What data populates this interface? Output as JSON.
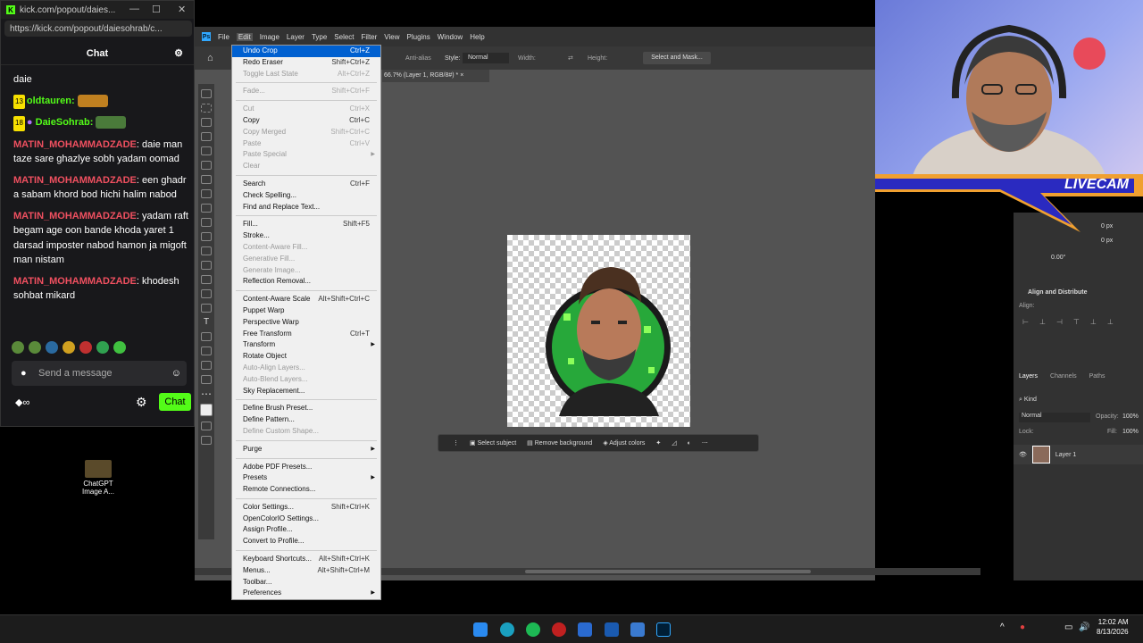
{
  "chat_window": {
    "title": "kick.com/popout/daies...",
    "url": "https://kick.com/popout/daiesohrab/c...",
    "header": "Chat",
    "messages": [
      {
        "user": "",
        "text": "daie"
      },
      {
        "badge": "13",
        "user": "oldtauren:",
        "text": ""
      },
      {
        "badge": "18",
        "user": "DaieSohrab:",
        "text": ""
      },
      {
        "user": "MATIN_MOHAMMADZADE",
        "text": ": daie man taze sare ghazlye sobh yadam oomad"
      },
      {
        "user": "MATIN_MOHAMMADZADE",
        "text": ": een ghadr a sabam khord bod hichi halim nabod"
      },
      {
        "user": "MATIN_MOHAMMADZADE",
        "text": ": yadam raft begam age oon bande khoda yaret 1 darsad imposter nabod hamon ja migoft man nistam"
      },
      {
        "user": "MATIN_MOHAMMADZADE",
        "text": ": khodesh sohbat mikard"
      }
    ],
    "input_placeholder": "Send a message",
    "send_label": "Chat",
    "infinity": "∞"
  },
  "desktop_icon": {
    "label": "ChatGPT Image A..."
  },
  "photoshop": {
    "menus": [
      "File",
      "Edit",
      "Image",
      "Layer",
      "Type",
      "Select",
      "Filter",
      "View",
      "Plugins",
      "Window",
      "Help"
    ],
    "options": {
      "antialias": "Anti-alias",
      "style_label": "Style:",
      "style_value": "Normal",
      "width": "Width:",
      "height": "Height:",
      "select_mask": "Select and Mask..."
    },
    "doc_tab": "66.7% (Layer 1, RGB/8#) *",
    "context_bar": [
      "Select subject",
      "Remove background",
      "Adjust colors"
    ],
    "edit_menu": [
      {
        "label": "Undo Crop",
        "sc": "Ctrl+Z",
        "state": "hl"
      },
      {
        "label": "Redo Eraser",
        "sc": "Shift+Ctrl+Z"
      },
      {
        "label": "Toggle Last State",
        "sc": "Alt+Ctrl+Z",
        "state": "dis"
      },
      {
        "sep": true
      },
      {
        "label": "Fade...",
        "sc": "Shift+Ctrl+F",
        "state": "dis"
      },
      {
        "sep": true
      },
      {
        "label": "Cut",
        "sc": "Ctrl+X",
        "state": "dis"
      },
      {
        "label": "Copy",
        "sc": "Ctrl+C"
      },
      {
        "label": "Copy Merged",
        "sc": "Shift+Ctrl+C",
        "state": "dis"
      },
      {
        "label": "Paste",
        "sc": "Ctrl+V",
        "state": "dis"
      },
      {
        "label": "Paste Special",
        "sc": "",
        "state": "dis",
        "sub": true
      },
      {
        "label": "Clear",
        "sc": "",
        "state": "dis"
      },
      {
        "sep": true
      },
      {
        "label": "Search",
        "sc": "Ctrl+F"
      },
      {
        "label": "Check Spelling...",
        "sc": ""
      },
      {
        "label": "Find and Replace Text...",
        "sc": ""
      },
      {
        "sep": true
      },
      {
        "label": "Fill...",
        "sc": "Shift+F5"
      },
      {
        "label": "Stroke...",
        "sc": ""
      },
      {
        "label": "Content-Aware Fill...",
        "sc": "",
        "state": "dis"
      },
      {
        "label": "Generative Fill...",
        "sc": "",
        "state": "dis"
      },
      {
        "label": "Generate Image...",
        "sc": "",
        "state": "dis"
      },
      {
        "label": "Reflection Removal...",
        "sc": ""
      },
      {
        "sep": true
      },
      {
        "label": "Content-Aware Scale",
        "sc": "Alt+Shift+Ctrl+C"
      },
      {
        "label": "Puppet Warp",
        "sc": ""
      },
      {
        "label": "Perspective Warp",
        "sc": ""
      },
      {
        "label": "Free Transform",
        "sc": "Ctrl+T"
      },
      {
        "label": "Transform",
        "sc": "",
        "sub": true
      },
      {
        "label": "Rotate Object",
        "sc": ""
      },
      {
        "label": "Auto-Align Layers...",
        "sc": "",
        "state": "dis"
      },
      {
        "label": "Auto-Blend Layers...",
        "sc": "",
        "state": "dis"
      },
      {
        "label": "Sky Replacement...",
        "sc": ""
      },
      {
        "sep": true
      },
      {
        "label": "Define Brush Preset...",
        "sc": ""
      },
      {
        "label": "Define Pattern...",
        "sc": ""
      },
      {
        "label": "Define Custom Shape...",
        "sc": "",
        "state": "dis"
      },
      {
        "sep": true
      },
      {
        "label": "Purge",
        "sc": "",
        "sub": true
      },
      {
        "sep": true
      },
      {
        "label": "Adobe PDF Presets...",
        "sc": ""
      },
      {
        "label": "Presets",
        "sc": "",
        "sub": true
      },
      {
        "label": "Remote Connections...",
        "sc": ""
      },
      {
        "sep": true
      },
      {
        "label": "Color Settings...",
        "sc": "Shift+Ctrl+K"
      },
      {
        "label": "OpenColorIO Settings...",
        "sc": ""
      },
      {
        "label": "Assign Profile...",
        "sc": ""
      },
      {
        "label": "Convert to Profile...",
        "sc": ""
      },
      {
        "sep": true
      },
      {
        "label": "Keyboard Shortcuts...",
        "sc": "Alt+Shift+Ctrl+K"
      },
      {
        "label": "Menus...",
        "sc": "Alt+Shift+Ctrl+M"
      },
      {
        "label": "Toolbar...",
        "sc": ""
      },
      {
        "label": "Preferences",
        "sc": "",
        "sub": true
      }
    ],
    "right_panel": {
      "px1": "0 px",
      "px2": "0 px",
      "deg": "0.00°",
      "align_title": "Align and Distribute",
      "align_label": "Align:",
      "tabs": [
        "Layers",
        "Channels",
        "Paths"
      ],
      "kind": "Kind",
      "blend": "Normal",
      "opacity_label": "Opacity:",
      "opacity": "100%",
      "lock_label": "Lock:",
      "fill_label": "Fill:",
      "fill": "100%",
      "layer_name": "Layer 1"
    }
  },
  "webcam": {
    "overlay": "LIVECAM"
  },
  "taskbar": {
    "time": "12:02 AM",
    "date": "8/13/2026"
  }
}
